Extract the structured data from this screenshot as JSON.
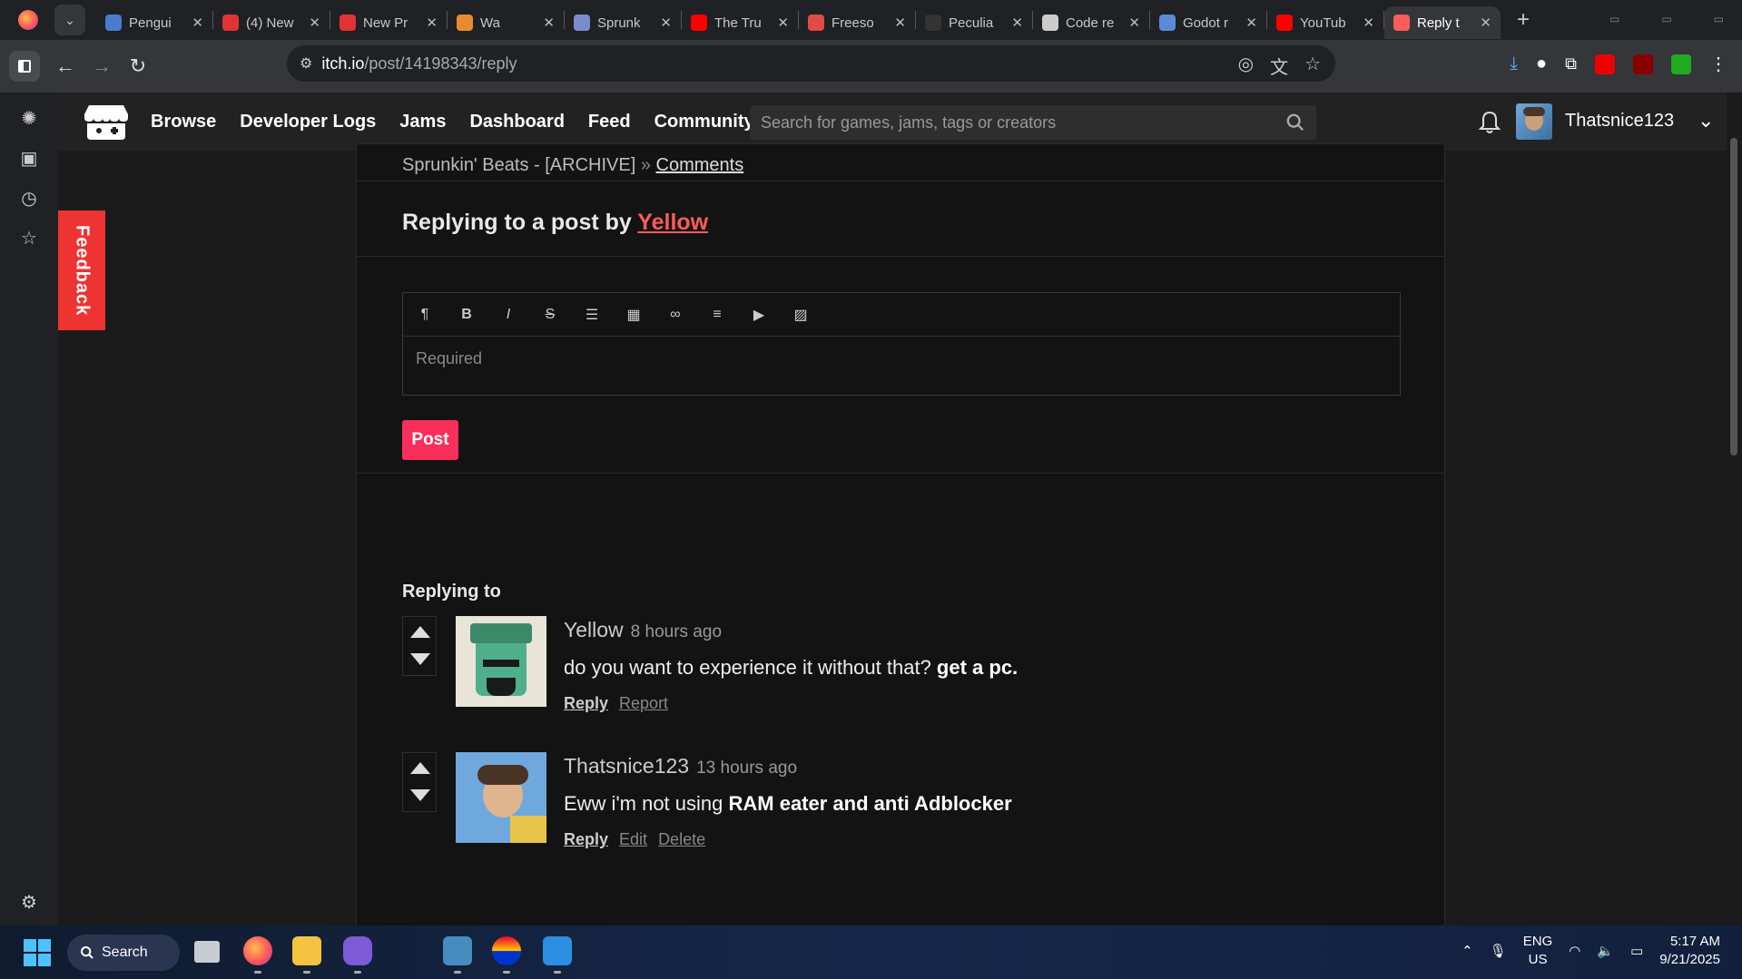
{
  "browser": {
    "tabs": [
      {
        "title": "Pengui",
        "color": "#4a7bd0"
      },
      {
        "title": "(4) New",
        "color": "#e03434"
      },
      {
        "title": "New Pr",
        "color": "#e03434"
      },
      {
        "title": "Wa",
        "color": "#e88b2e"
      },
      {
        "title": "Sprunk",
        "color": "#7a8cc9"
      },
      {
        "title": "The Tru",
        "color": "#ff0000"
      },
      {
        "title": "Freeso",
        "color": "#e04a4a"
      },
      {
        "title": "Peculia",
        "color": "#333333"
      },
      {
        "title": "Code re",
        "color": "#cccccc"
      },
      {
        "title": "Godot r",
        "color": "#5a8ad8"
      },
      {
        "title": "YouTub",
        "color": "#ff0000"
      },
      {
        "title": "Reply t",
        "color": "#fa5c5c",
        "active": true
      }
    ],
    "url_host": "itch.io",
    "url_path": "/post/14198343/reply"
  },
  "header": {
    "nav": [
      "Browse",
      "Developer Logs",
      "Jams",
      "Dashboard",
      "Feed",
      "Community"
    ],
    "search_placeholder": "Search for games, jams, tags or creators",
    "username": "Thatsnice123"
  },
  "feedback_label": "Feedback",
  "breadcrumb": {
    "game": "Sprunkin' Beats - [ARCHIVE]",
    "sep": "»",
    "link": "Comments"
  },
  "reply": {
    "prefix": "Replying to a post by ",
    "author": "Yellow",
    "placeholder": "Required",
    "post_label": "Post"
  },
  "editor_tools": [
    "paragraph-icon",
    "bold-icon",
    "italic-icon",
    "strikethrough-icon",
    "bullet-list-icon",
    "table-icon",
    "link-icon",
    "align-icon",
    "video-icon",
    "image-icon"
  ],
  "replying_to_label": "Replying to",
  "comments": [
    {
      "author": "Yellow",
      "time": "8 hours ago",
      "text_plain": "do you want to experience it without that? ",
      "text_bold": "get a pc.",
      "actions": [
        "Reply",
        "Report"
      ]
    },
    {
      "author": "Thatsnice123",
      "time": "13 hours ago",
      "text_plain": "Eww i'm not using ",
      "text_bold": "RAM eater and anti Adblocker",
      "actions": [
        "Reply",
        "Edit",
        "Delete"
      ]
    }
  ],
  "taskbar": {
    "search_label": "Search",
    "lang_top": "ENG",
    "lang_bottom": "US",
    "time": "5:17 AM",
    "date": "9/21/2025"
  }
}
